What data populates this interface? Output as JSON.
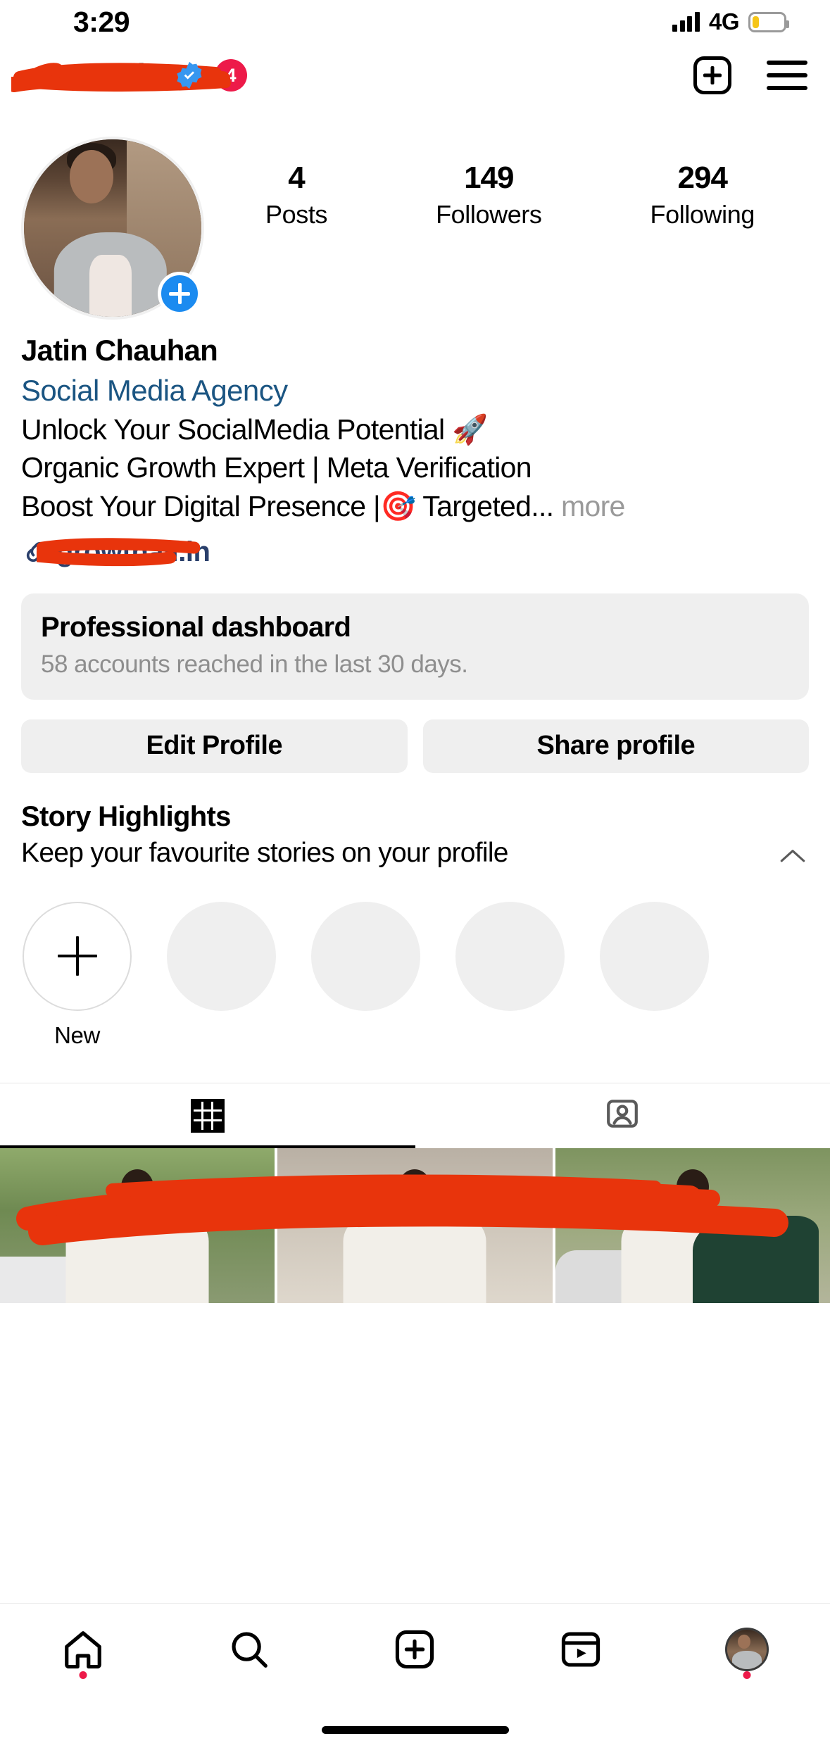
{
  "status_bar": {
    "time": "3:29",
    "network": "4G",
    "signal_icon": "signal-bars-icon",
    "battery_icon": "battery-low-icon",
    "battery_level_percent": 22
  },
  "header": {
    "username": "•••••••••••in",
    "username_redacted": true,
    "verified_icon": "verified-badge-icon",
    "notification_count": "4",
    "new_post_icon": "plus-square-icon",
    "menu_icon": "hamburger-menu-icon"
  },
  "profile": {
    "avatar_icon": "profile-avatar",
    "add_story_icon": "plus-icon",
    "stats": [
      {
        "value": "4",
        "label": "Posts"
      },
      {
        "value": "149",
        "label": "Followers"
      },
      {
        "value": "294",
        "label": "Following"
      }
    ],
    "name": "Jatin Chauhan",
    "category": "Social Media Agency",
    "bio_lines": [
      "Unlock Your SocialMedia Potential 🚀",
      "Organic Growth Expert | Meta Verification"
    ],
    "bio_last_line": "Boost Your Digital Presence |🎯 Targeted",
    "bio_truncation": "...",
    "more_label": "more",
    "link_icon": "link-chain-icon",
    "link_text": "growthall.in",
    "link_redacted": true
  },
  "dashboard": {
    "title": "Professional dashboard",
    "subtitle": "58 accounts reached in the last 30 days."
  },
  "actions": {
    "edit_profile_label": "Edit Profile",
    "share_profile_label": "Share profile"
  },
  "highlights": {
    "title": "Story Highlights",
    "subtitle": "Keep your favourite stories on your profile",
    "collapse_icon": "chevron-up-icon",
    "items": [
      {
        "label": "New",
        "type": "new",
        "icon": "plus-icon"
      },
      {
        "label": "",
        "type": "placeholder",
        "icon": ""
      },
      {
        "label": "",
        "type": "placeholder",
        "icon": ""
      },
      {
        "label": "",
        "type": "placeholder",
        "icon": ""
      },
      {
        "label": "",
        "type": "placeholder",
        "icon": ""
      }
    ]
  },
  "tabs": [
    {
      "name": "grid",
      "icon": "grid-icon",
      "active": true
    },
    {
      "name": "tagged",
      "icon": "tagged-person-icon",
      "active": false
    }
  ],
  "posts": [
    {
      "alt": "post-thumbnail-1",
      "redacted": true
    },
    {
      "alt": "post-thumbnail-2",
      "redacted": true
    },
    {
      "alt": "post-thumbnail-3",
      "redacted": true
    }
  ],
  "bottom_nav": [
    {
      "name": "home",
      "icon": "home-icon",
      "badge_dot": true
    },
    {
      "name": "search",
      "icon": "search-icon",
      "badge_dot": false
    },
    {
      "name": "create",
      "icon": "plus-square-icon",
      "badge_dot": false
    },
    {
      "name": "reels",
      "icon": "reels-icon",
      "badge_dot": false
    },
    {
      "name": "profile",
      "icon": "profile-avatar-icon",
      "badge_dot": true
    }
  ],
  "colors": {
    "accent_blue": "#1b8bf0",
    "category_blue": "#1b5582",
    "badge_red": "#ed1a49",
    "redaction_red": "#e8340c",
    "surface_grey": "#efefef",
    "muted_text": "#8e8e8e"
  }
}
